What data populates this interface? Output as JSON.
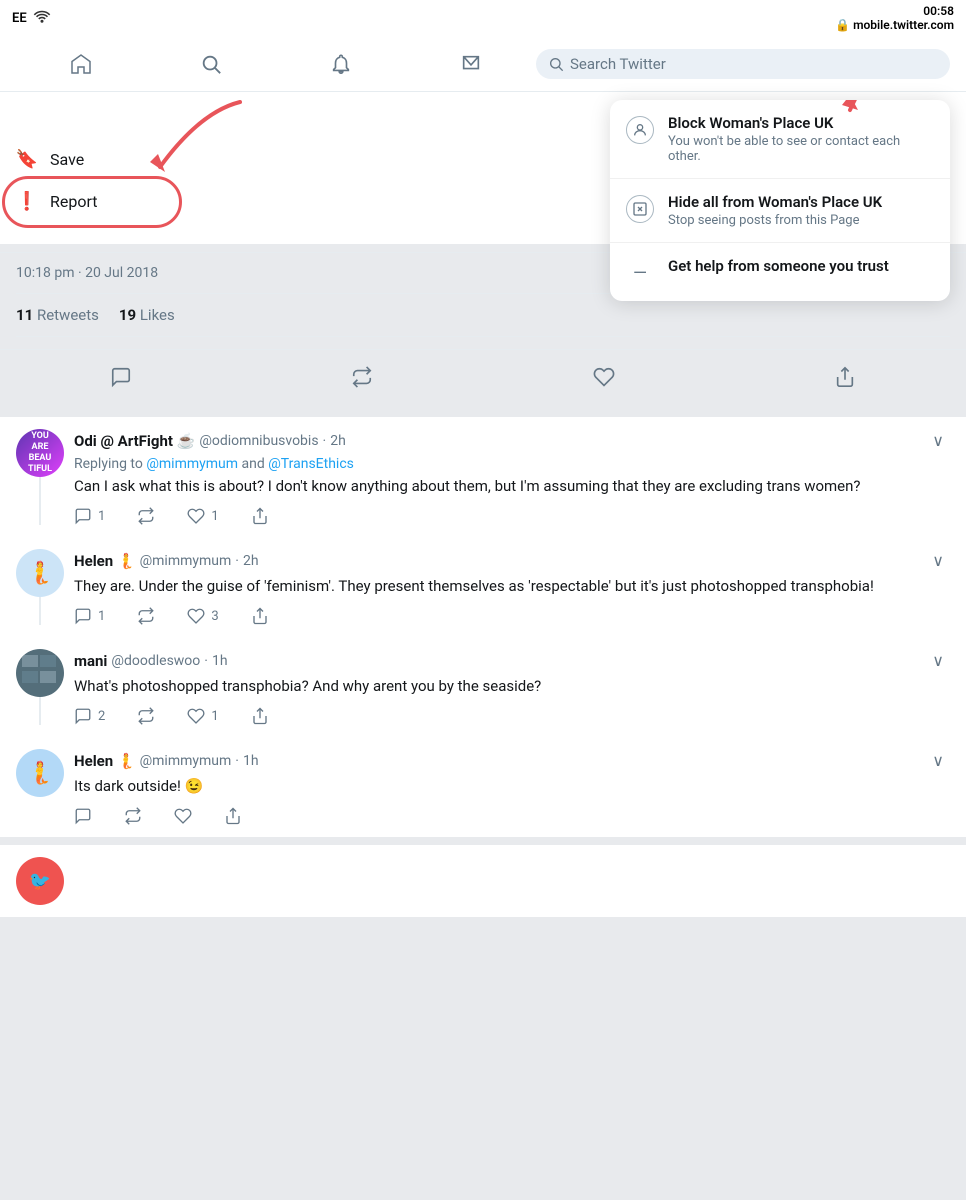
{
  "statusBar": {
    "carrier": "EE",
    "wifi": "WiFi",
    "time": "00:58",
    "url": "mobile.twitter.com"
  },
  "navBar": {
    "searchPlaceholder": "Search Twitter"
  },
  "contextMenu": {
    "leftItems": [
      {
        "id": "save",
        "icon": "🔖",
        "label": "Save"
      },
      {
        "id": "report",
        "icon": "❗",
        "label": "Report"
      }
    ],
    "rightItems": [
      {
        "id": "block",
        "icon": "👤",
        "title": "Block Woman's Place UK",
        "subtitle": "You won't be able to see or contact each other."
      },
      {
        "id": "hide",
        "icon": "✖",
        "title": "Hide all from Woman's Place UK",
        "subtitle": "Stop seeing posts from this Page"
      },
      {
        "id": "help",
        "icon": "—",
        "title": "Get help from someone you trust",
        "subtitle": ""
      }
    ]
  },
  "tweetMeta": {
    "timestamp": "10:18 pm · 20 Jul 2018",
    "retweets": "11",
    "retweetsLabel": "Retweets",
    "likes": "19",
    "likesLabel": "Likes"
  },
  "replies": [
    {
      "id": "odi",
      "name": "Odi @ ArtFight ☕",
      "handle": "@odiomnibusvobis",
      "time": "2h",
      "replyingTo": "@mimmymum and @TransEthics",
      "text": "Can I ask what this is about? I don't know anything about them, but I'm assuming that they are excluding trans women?",
      "avatarType": "odi",
      "actions": {
        "reply": "1",
        "retweet": "",
        "like": "1",
        "share": ""
      },
      "hasThread": true
    },
    {
      "id": "helen1",
      "name": "Helen 🧜",
      "handle": "@mimmymum",
      "time": "2h",
      "replyingTo": null,
      "text": "They are. Under the guise of 'feminism'. They present themselves as 'respectable' but it's just photoshopped transphobia!",
      "avatarType": "helen",
      "actions": {
        "reply": "1",
        "retweet": "",
        "like": "3",
        "share": ""
      },
      "hasThread": true
    },
    {
      "id": "mani",
      "name": "mani",
      "handle": "@doodleswoo",
      "time": "1h",
      "replyingTo": null,
      "text": "What's photoshopped transphobia? And why arent you by the seaside?",
      "avatarType": "mani",
      "actions": {
        "reply": "2",
        "retweet": "",
        "like": "1",
        "share": ""
      },
      "hasThread": true
    },
    {
      "id": "helen2",
      "name": "Helen 🧜",
      "handle": "@mimmymum",
      "time": "1h",
      "replyingTo": null,
      "text": "Its dark outside! 😉",
      "avatarType": "helen",
      "actions": {
        "reply": "",
        "retweet": "",
        "like": "",
        "share": ""
      },
      "hasThread": false
    }
  ]
}
